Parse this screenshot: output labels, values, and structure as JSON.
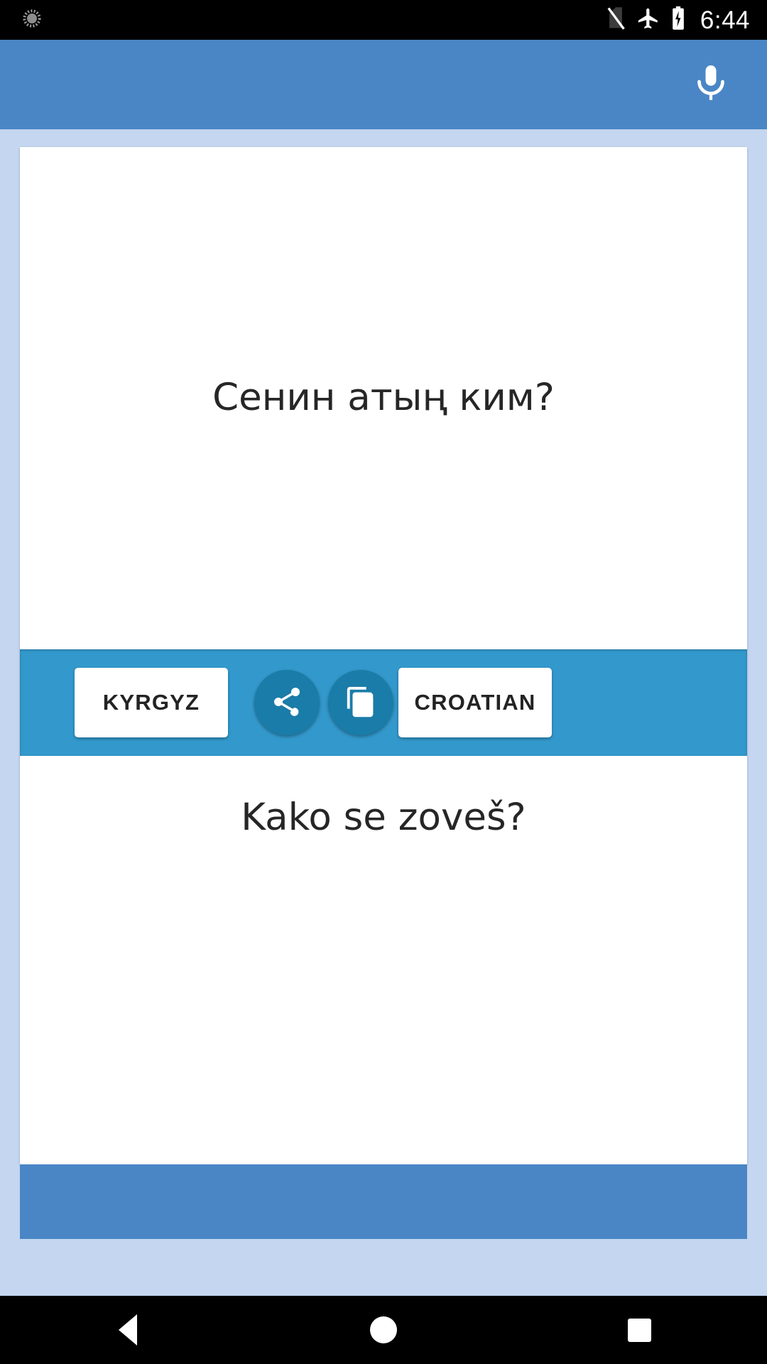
{
  "status_bar": {
    "notification_icon": "alarm-icon",
    "icons": [
      "no-sim-icon",
      "airplane-mode-icon",
      "battery-charging-icon"
    ],
    "clock": "6:44"
  },
  "app_header": {
    "background_color": "#4a86c5",
    "mic_icon": "microphone-icon"
  },
  "translator": {
    "source_text": "Сенин атың ким?",
    "target_text": "Kako se zoveš?",
    "source_language": "KYRGYZ",
    "target_language": "CROATIAN",
    "toolbar_color": "#3399cc",
    "fab_color": "#1a7ca8",
    "share_icon": "share-icon",
    "copy_icon": "copy-icon"
  },
  "nav_bar": {
    "back_label": "Back",
    "home_label": "Home",
    "recents_label": "Recents"
  }
}
